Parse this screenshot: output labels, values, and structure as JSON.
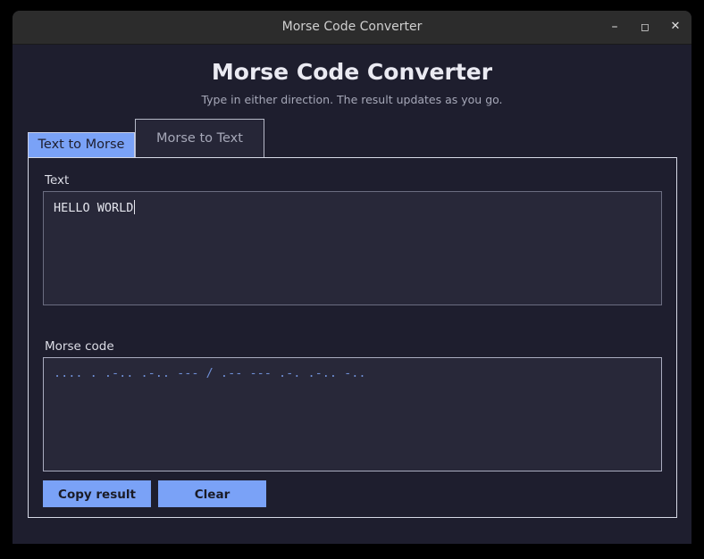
{
  "window": {
    "title": "Morse Code Converter",
    "minimize_glyph": "–",
    "maximize_glyph": "◻",
    "close_glyph": "✕"
  },
  "header": {
    "title": "Morse Code Converter",
    "subtitle": "Type in either direction. The result updates as you go."
  },
  "tabs": [
    {
      "label": "Text to Morse",
      "active": true
    },
    {
      "label": "Morse to Text",
      "active": false
    }
  ],
  "input": {
    "label": "Text",
    "value": "HELLO WORLD"
  },
  "output": {
    "label": "Morse code",
    "value": ".... . .-.. .-.. --- / .-- --- .-. .-.. -.."
  },
  "buttons": {
    "copy_label": "Copy result",
    "clear_label": "Clear"
  },
  "colors": {
    "accent": "#7aa2f7",
    "background": "#1e1e2e",
    "field": "#282839",
    "morse_text": "#6f8fd6"
  }
}
